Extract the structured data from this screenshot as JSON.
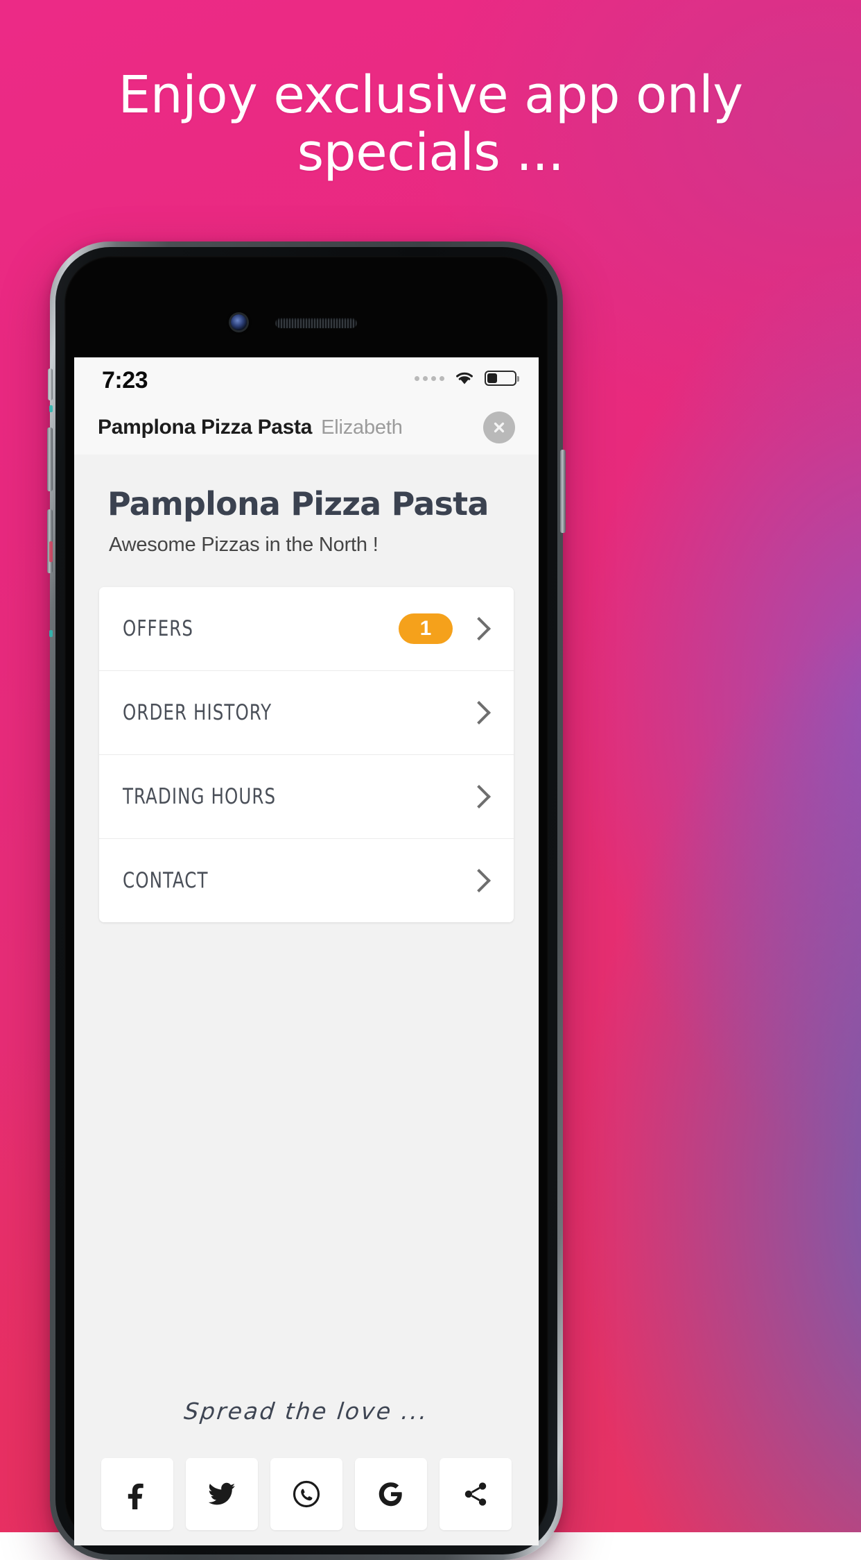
{
  "promo": {
    "headline_line1": "Enjoy exclusive app only",
    "headline_line2": "specials ...",
    "background_start": "#ec2a86",
    "background_end": "#5c68be"
  },
  "device": {
    "camera_icon": "front-camera",
    "speaker_icon": "earpiece-speaker"
  },
  "status_bar": {
    "time": "7:23",
    "signal_icon": "signal-dots",
    "wifi_icon": "wifi-icon",
    "battery_icon": "battery-icon",
    "battery_level_percent": 33
  },
  "app_header": {
    "venue_name": "Pamplona Pizza Pasta",
    "location": "Elizabeth",
    "close_icon": "close-icon"
  },
  "venue": {
    "title": "Pamplona Pizza Pasta",
    "tagline": "Awesome Pizzas in the North !"
  },
  "menu": {
    "rows": [
      {
        "label": "OFFERS",
        "badge": "1",
        "chevron_icon": "chevron-right-icon"
      },
      {
        "label": "ORDER HISTORY",
        "badge": "",
        "chevron_icon": "chevron-right-icon"
      },
      {
        "label": "TRADING HOURS",
        "badge": "",
        "chevron_icon": "chevron-right-icon"
      },
      {
        "label": "CONTACT",
        "badge": "",
        "chevron_icon": "chevron-right-icon"
      }
    ],
    "badge_color": "#f5a11b"
  },
  "footer": {
    "share_prompt": "Spread the love ...",
    "socials": [
      {
        "name": "facebook-icon"
      },
      {
        "name": "twitter-icon"
      },
      {
        "name": "whatsapp-icon"
      },
      {
        "name": "google-icon"
      },
      {
        "name": "share-icon"
      }
    ]
  }
}
